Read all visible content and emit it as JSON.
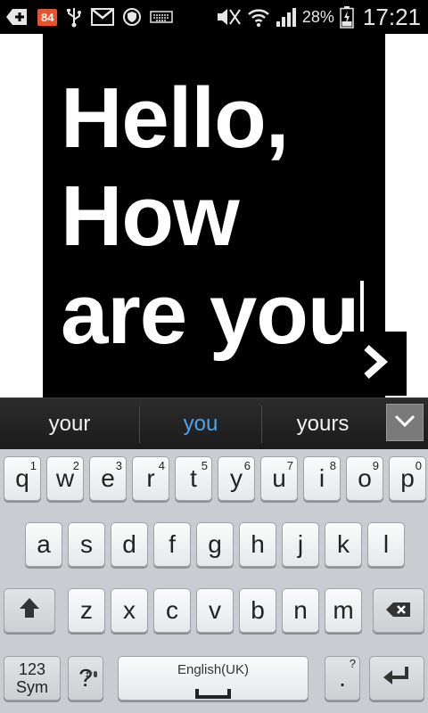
{
  "status_bar": {
    "icons": [
      "add-icon",
      "notification-badge",
      "usb-icon",
      "gmail-icon",
      "shield-icon",
      "keyboard-icon",
      "mute-icon",
      "wifi-icon",
      "signal-icon",
      "battery-icon"
    ],
    "badge_count": "84",
    "battery": "28%",
    "time": "17:21"
  },
  "canvas": {
    "text_lines": [
      "Hello,",
      "How",
      "are you"
    ],
    "next_icon": "chevron-right-icon"
  },
  "suggestions": {
    "items": [
      "your",
      "you",
      "yours"
    ],
    "active_index": 1,
    "collapse_icon": "chevron-down-icon"
  },
  "keyboard": {
    "row1": [
      {
        "label": "q",
        "num": "1"
      },
      {
        "label": "w",
        "num": "2"
      },
      {
        "label": "e",
        "num": "3"
      },
      {
        "label": "r",
        "num": "4"
      },
      {
        "label": "t",
        "num": "5"
      },
      {
        "label": "y",
        "num": "6"
      },
      {
        "label": "u",
        "num": "7"
      },
      {
        "label": "i",
        "num": "8"
      },
      {
        "label": "o",
        "num": "9"
      },
      {
        "label": "p",
        "num": "0"
      }
    ],
    "row2": [
      "a",
      "s",
      "d",
      "f",
      "g",
      "h",
      "j",
      "k",
      "l"
    ],
    "row3": [
      "z",
      "x",
      "c",
      "v",
      "b",
      "n",
      "m"
    ],
    "sym_label_1": "123",
    "sym_label_2": "Sym",
    "q_mark": "?",
    "space_label": "English(UK)",
    "period": ".",
    "period_hint": "?",
    "shift_icon": "shift-arrow-icon",
    "backspace_icon": "backspace-icon",
    "enter_icon": "enter-arrow-icon",
    "mic_icon": "settings-mic-icon"
  }
}
